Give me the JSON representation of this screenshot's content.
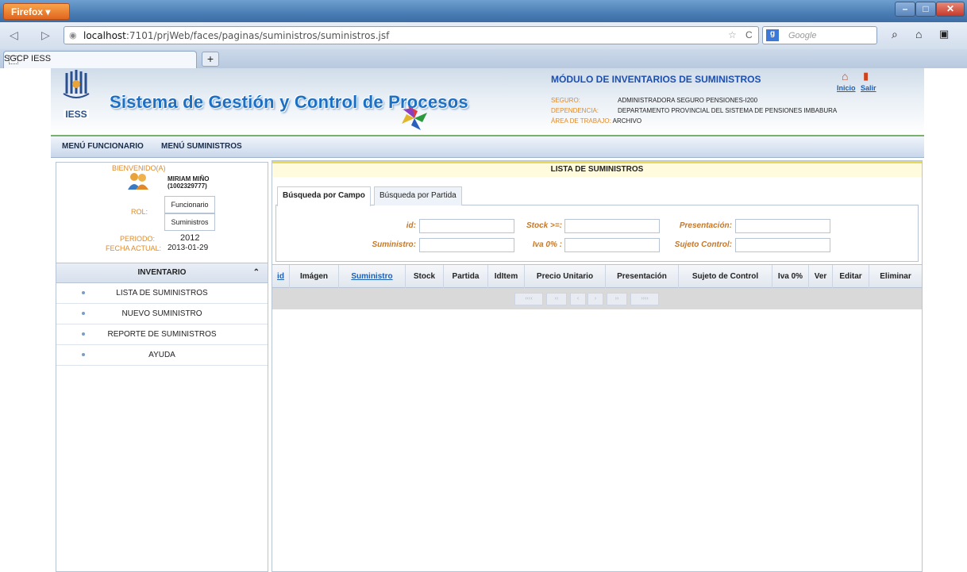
{
  "browser": {
    "app_button": "Firefox",
    "url_host": "localhost",
    "url_rest": ":7101/prjWeb/faces/paginas/suministros/suministros.jsf",
    "search_placeholder": "Google",
    "tab_title": "SGCP IESS",
    "new_tab": "+"
  },
  "header": {
    "logo_text": "IESS",
    "system_title": "Sistema de Gestión y Control de Procesos",
    "module_title": "MÓDULO DE INVENTARIOS DE SUMINISTROS",
    "info": [
      {
        "key": "SEGURO:",
        "value": "ADMINISTRADORA SEGURO PENSIONES-I200"
      },
      {
        "key": "DEPENDENCIA:",
        "value": "DEPARTAMENTO PROVINCIAL DEL SISTEMA DE PENSIONES IMBABURA"
      },
      {
        "key": "ÁREA DE TRABAJO:",
        "value": "ARCHIVO"
      }
    ],
    "home_link": "Inicio",
    "exit_link": "Salir"
  },
  "menu": {
    "item1": "MENÚ FUNCIONARIO",
    "item2": "MENÚ SUMINISTROS"
  },
  "user": {
    "welcome": "BIENVENIDO(A)",
    "name": "MIRIAM MIÑO",
    "id": "(1002329777)",
    "role_label": "ROL:",
    "roles": [
      "Funcionario",
      "Suministros"
    ],
    "period_label": "PERIODO:",
    "period": "2012",
    "date_label": "FECHA ACTUAL:",
    "date": "2013-01-29"
  },
  "inventory": {
    "title": "INVENTARIO",
    "items": [
      "LISTA DE SUMINISTROS",
      "NUEVO SUMINISTRO",
      "REPORTE DE SUMINISTROS",
      "AYUDA"
    ]
  },
  "main": {
    "title": "LISTA DE SUMINISTROS",
    "tabs": [
      "Búsqueda por Campo",
      "Búsqueda por Partida"
    ],
    "fields": {
      "id": "id:",
      "stock": "Stock >=:",
      "presentacion": "Presentación:",
      "suministro": "Suministro:",
      "iva": "Iva 0% :",
      "sujeto": "Sujeto Control:"
    },
    "columns": [
      "id",
      "Imágen",
      "Suministro",
      "Stock",
      "Partida",
      "IdItem",
      "Precio Unitario",
      "Presentación",
      "Sujeto de Control",
      "Iva 0%",
      "Ver",
      "Editar",
      "Eliminar"
    ],
    "pager": [
      "‹‹‹‹",
      "‹‹",
      "‹",
      "›",
      "››",
      "››››"
    ]
  },
  "colors": {
    "title_blue": "#1d6fc4",
    "label_orange": "#c5772a",
    "header_yellow": "#fffbdc"
  }
}
